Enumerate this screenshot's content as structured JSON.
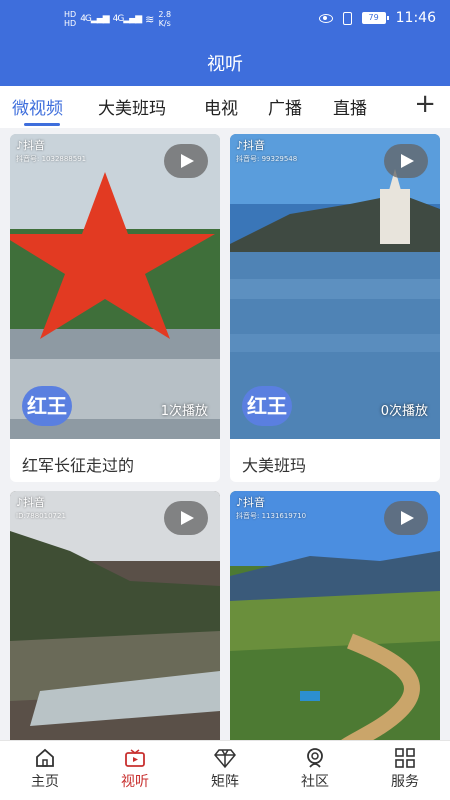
{
  "status_bar": {
    "hd1": "HD",
    "hd2": "HD",
    "sim1": "4G",
    "sim2": "4G",
    "speed": "2.8",
    "speed_unit": "K/s",
    "battery": "79",
    "time": "11:46"
  },
  "header": {
    "title": "视听"
  },
  "tabs": [
    {
      "label": "微视频",
      "active": true
    },
    {
      "label": "大美班玛",
      "active": false
    },
    {
      "label": "电视",
      "active": false
    },
    {
      "label": "广播",
      "active": false
    },
    {
      "label": "直播",
      "active": false
    }
  ],
  "videos": [
    {
      "platform": "抖音",
      "platform_id": "抖音号: 1032888591",
      "plays": "1次播放",
      "avatar_text": "红王",
      "title": "红军长征走过的"
    },
    {
      "platform": "抖音",
      "platform_id": "抖音号: 99329548",
      "plays": "0次播放",
      "avatar_text": "红王",
      "title": "大美班玛"
    },
    {
      "platform": "抖音",
      "platform_id": "ID:788010721"
    },
    {
      "platform": "抖音",
      "platform_id": "抖音号: 1131619710"
    }
  ],
  "bottom_nav": [
    {
      "label": "主页",
      "icon": "home-icon"
    },
    {
      "label": "视听",
      "icon": "video-icon",
      "active": true
    },
    {
      "label": "矩阵",
      "icon": "diamond-icon"
    },
    {
      "label": "社区",
      "icon": "community-icon"
    },
    {
      "label": "服务",
      "icon": "grid-icon"
    }
  ],
  "colors": {
    "accent": "#3e6edc",
    "nav_active": "#c8302f"
  }
}
